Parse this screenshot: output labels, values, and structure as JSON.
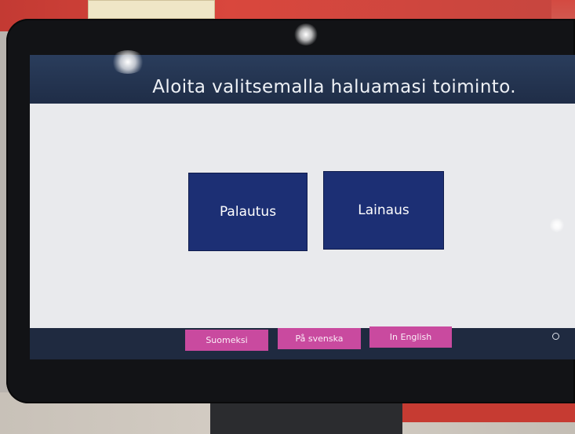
{
  "screen": {
    "header_title": "Aloita valitsemalla haluamasi toiminto.",
    "actions": [
      {
        "label": "Palautus"
      },
      {
        "label": "Lainaus"
      }
    ],
    "languages": [
      {
        "label": "Suomeksi"
      },
      {
        "label": "På svenska"
      },
      {
        "label": "In English"
      }
    ]
  },
  "colors": {
    "header_bg": "#24355a",
    "content_bg": "#e9eaed",
    "action_button": "#1c2f74",
    "language_button": "#c94a9f",
    "footer_bg": "#1f2a40"
  }
}
